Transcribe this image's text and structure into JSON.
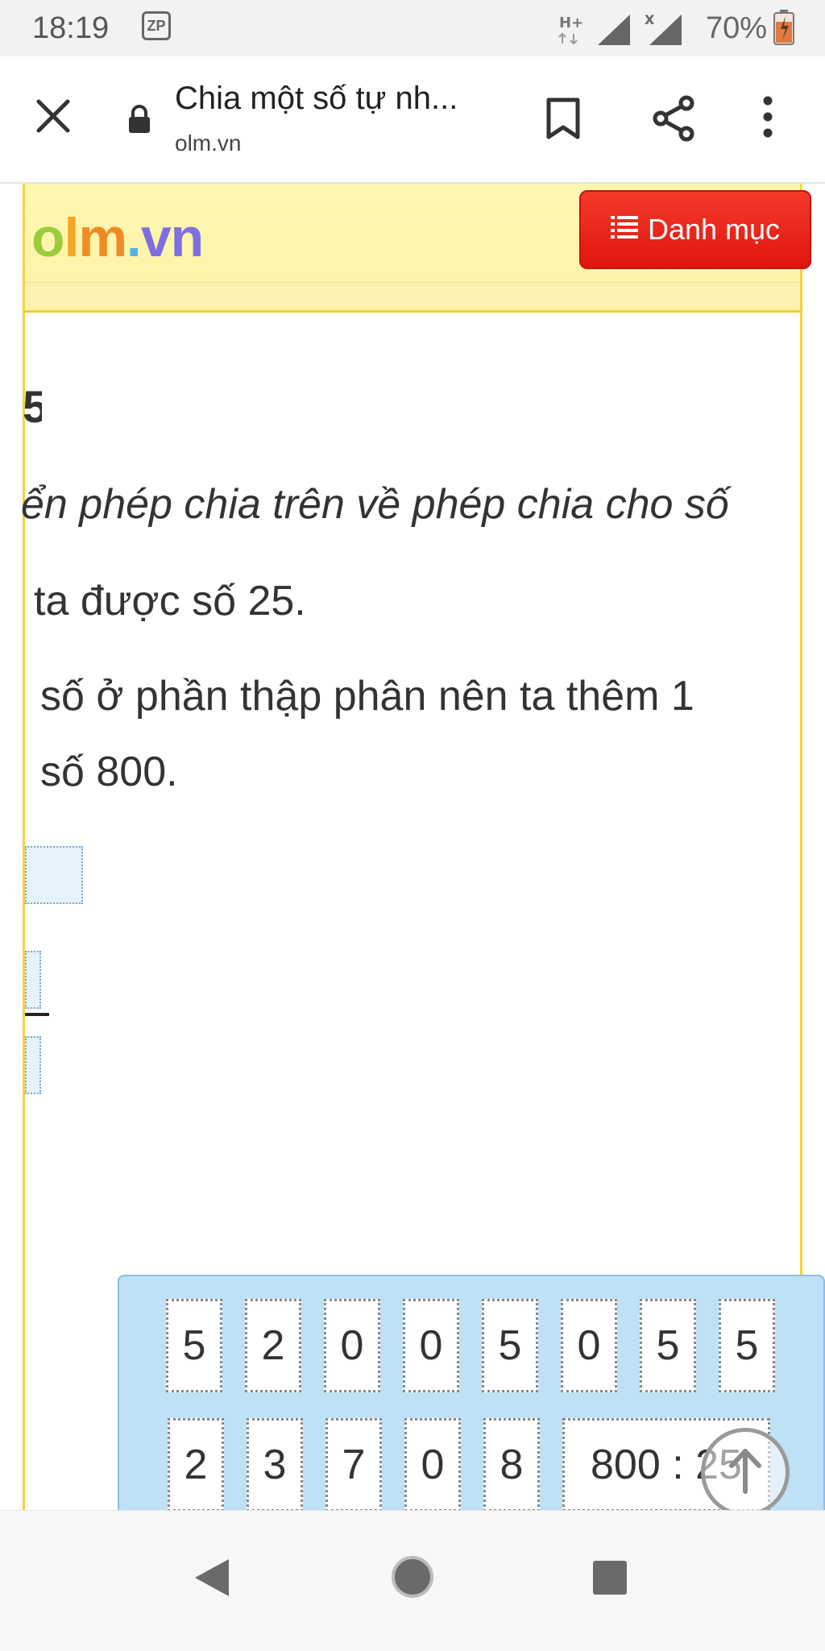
{
  "status_bar": {
    "time": "18:19",
    "notification_badge": "ZP",
    "network_type": "H+",
    "sim2_indicator": "X",
    "battery_percent": "70%"
  },
  "browser": {
    "page_title": "Chia một số tự nh...",
    "url": "olm.vn"
  },
  "site": {
    "logo_letters": [
      "o",
      "l",
      "m",
      ".",
      "vn"
    ],
    "menu_button_label": "Danh mục"
  },
  "content": {
    "heading_fragment": "5",
    "line_1": "ển phép chia trên về phép chia cho số",
    "line_2": "ta được số 25.",
    "line_3": "số ở phần thập phân nên ta thêm 1",
    "line_4": "số 800."
  },
  "tiles": {
    "row_1": [
      "5",
      "2",
      "0",
      "0",
      "5",
      "0",
      "5",
      "5"
    ],
    "row_2": [
      "2",
      "3",
      "7",
      "0",
      "8",
      "800 : 25"
    ]
  },
  "colors": {
    "header_bg": "#fff7b0",
    "frame_border": "#f6d23c",
    "menu_button_bg": "#e0150d",
    "tile_panel_bg": "#bfe1f5"
  },
  "icons": {
    "toolbar": [
      "close-icon",
      "lock-icon",
      "bookmark-icon",
      "share-icon",
      "more-vert-icon"
    ],
    "nav": [
      "back-icon",
      "home-icon",
      "recents-icon"
    ]
  }
}
